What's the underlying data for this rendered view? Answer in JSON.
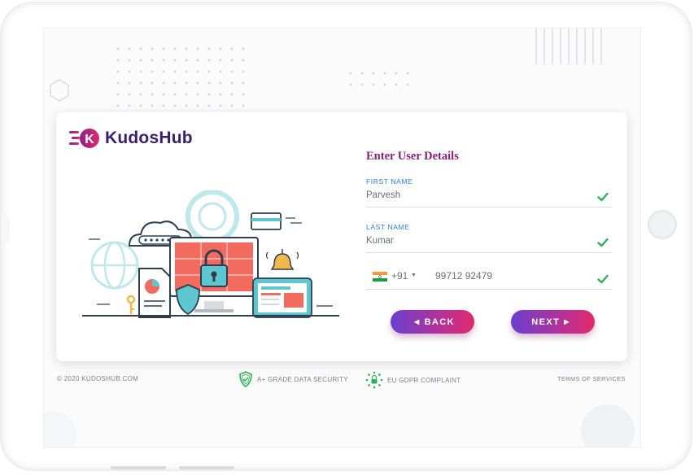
{
  "brand": {
    "name": "KudosHub",
    "accent": "#3a2069",
    "logo_gradient": [
      "#8c1f8a",
      "#e02a6b"
    ]
  },
  "form": {
    "title": "Enter User Details",
    "first_name": {
      "label": "FIRST NAME",
      "value": "Parvesh",
      "valid": true
    },
    "last_name": {
      "label": "LAST NAME",
      "value": "Kumar",
      "valid": true
    },
    "phone": {
      "country_icon": "india-flag-icon",
      "dial_code": "+91",
      "number": "99712 92479",
      "valid": true
    },
    "back_label": "BACK",
    "next_label": "NEXT",
    "button_gradient": [
      "#6a3fd0",
      "#c22f8e",
      "#e02a6b"
    ],
    "label_color": "#2a7fd4",
    "check_color": "#2eaf5c"
  },
  "footer": {
    "copyright": "© 2020 KUDOSHUB.COM",
    "security_badge": "A+ GRADE DATA SECURITY",
    "gdpr_badge": "EU GDPR COMPLAINT",
    "terms": "TERMS OF SERVICES"
  },
  "icons": {
    "security": "shield-check-icon",
    "gdpr": "eu-stars-lock-icon",
    "illustration": "cyber-security-illustration"
  }
}
